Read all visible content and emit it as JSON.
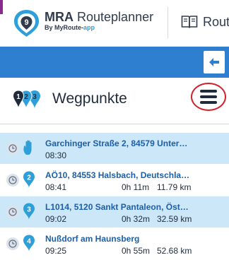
{
  "header": {
    "brand_name": "MRA",
    "brand_product": "Routeplanner",
    "brand_sub_prefix": "By MyRoute-",
    "brand_sub_app": "app",
    "nav_label": "Rout"
  },
  "panel": {
    "title": "Wegpunkte",
    "badge_numbers": [
      "1",
      "2",
      "3"
    ]
  },
  "waypoints": [
    {
      "number": "",
      "marker": "hand-icon",
      "title": "Garchinger Straße 2, 84579 Unter…",
      "time": "08:30",
      "duration": "",
      "distance": ""
    },
    {
      "number": "2",
      "marker": "pin",
      "title": "AÖ10, 84553 Halsbach, Deutschla…",
      "time": "08:41",
      "duration": "0h 11m",
      "distance": "11.79 km"
    },
    {
      "number": "3",
      "marker": "pin",
      "title": "L1014, 5120 Sankt Pantaleon, Öst…",
      "time": "09:02",
      "duration": "0h 32m",
      "distance": "32.59 km"
    },
    {
      "number": "4",
      "marker": "pin",
      "title": "Nußdorf am Haunsberg",
      "time": "09:25",
      "duration": "0h 55m",
      "distance": "52.68 km"
    }
  ],
  "colors": {
    "accent_blue": "#2e7fcf",
    "row_highlight": "#cce7f7",
    "title_blue": "#1c5fa8",
    "highlight_ring": "#d0202a"
  }
}
